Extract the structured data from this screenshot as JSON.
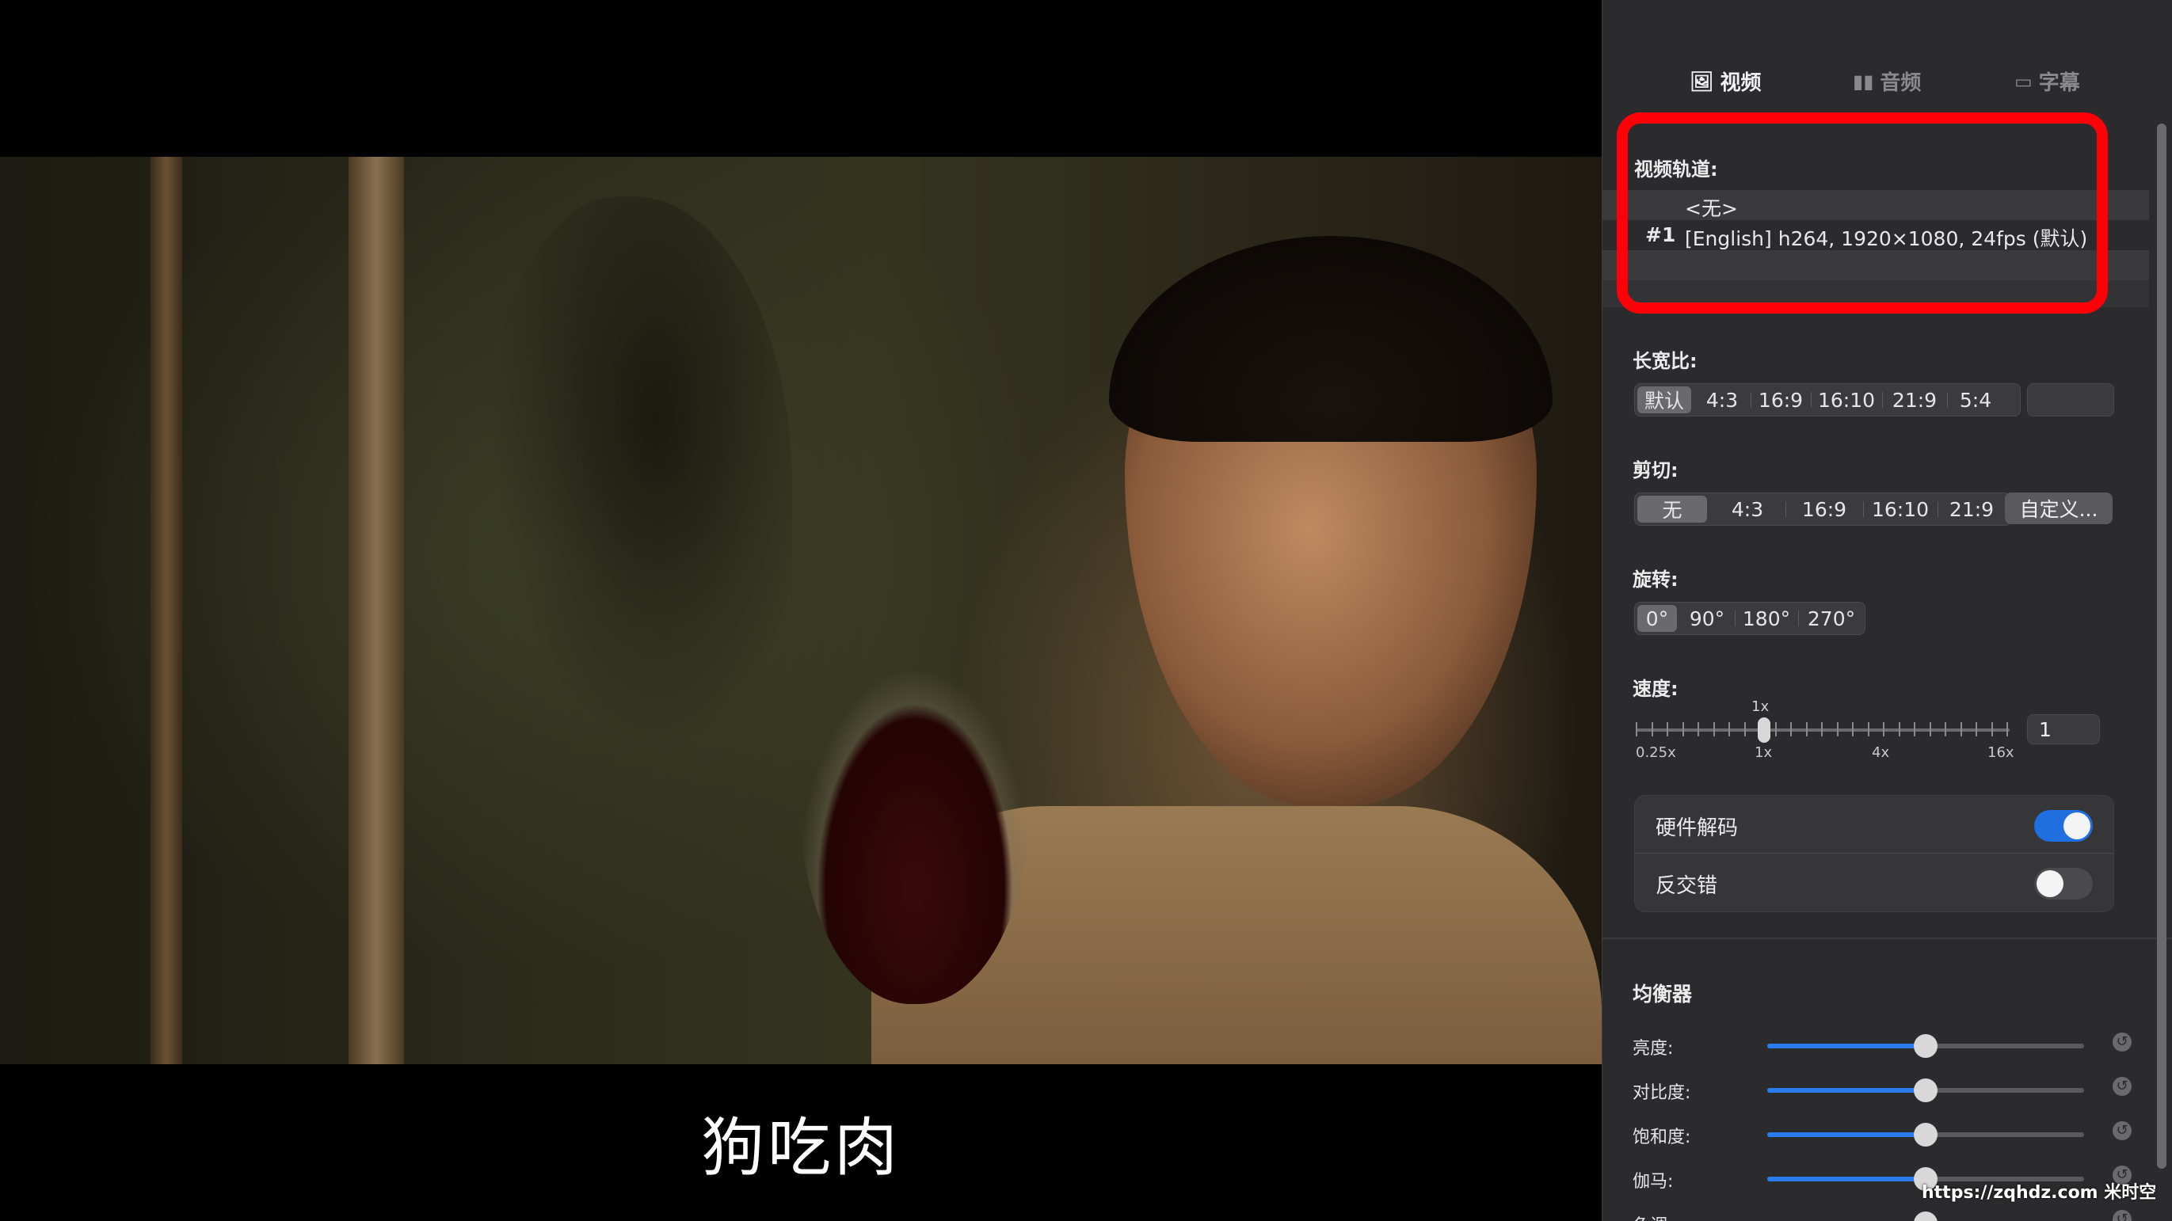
{
  "player": {
    "subtitle": "狗吃肉"
  },
  "panel": {
    "tabs": [
      {
        "label": "视频",
        "icon": "image-icon",
        "active": true
      },
      {
        "label": "音频",
        "icon": "waveform-icon",
        "active": false
      },
      {
        "label": "字幕",
        "icon": "speech-bubble-icon",
        "active": false
      }
    ],
    "video_track": {
      "label": "视频轨道:",
      "tracks": [
        {
          "num": "",
          "text": "<无>"
        },
        {
          "num": "#1",
          "text": "[English] h264, 1920×1080, 24fps (默认)"
        }
      ]
    },
    "aspect": {
      "label": "长宽比:",
      "options": [
        "默认",
        "4:3",
        "16:9",
        "16:10",
        "21:9",
        "5:4"
      ],
      "selected": "默认"
    },
    "crop": {
      "label": "剪切:",
      "options": [
        "无",
        "4:3",
        "16:9",
        "16:10",
        "21:9"
      ],
      "selected": "无",
      "custom_label": "自定义..."
    },
    "rotate": {
      "label": "旋转:",
      "options": [
        "0°",
        "90°",
        "180°",
        "270°"
      ],
      "selected": "0°"
    },
    "speed": {
      "label": "速度:",
      "current_label": "1x",
      "marks": [
        "0.25x",
        "1x",
        "4x",
        "16x"
      ],
      "value": "1"
    },
    "toggles": [
      {
        "label": "硬件解码",
        "on": true
      },
      {
        "label": "反交错",
        "on": false
      }
    ],
    "equalizer": {
      "label": "均衡器",
      "rows": [
        {
          "label": "亮度:",
          "value": 0.5
        },
        {
          "label": "对比度:",
          "value": 0.5
        },
        {
          "label": "饱和度:",
          "value": 0.5
        },
        {
          "label": "伽马:",
          "value": 0.5
        },
        {
          "label": "色调:",
          "value": 0.5
        }
      ]
    }
  },
  "watermark": "https://zqhdz.com 米时空",
  "colors": {
    "accent": "#1f6fe0",
    "highlight_box": "#ff0008",
    "panel_bg": "#2b2b2d"
  }
}
